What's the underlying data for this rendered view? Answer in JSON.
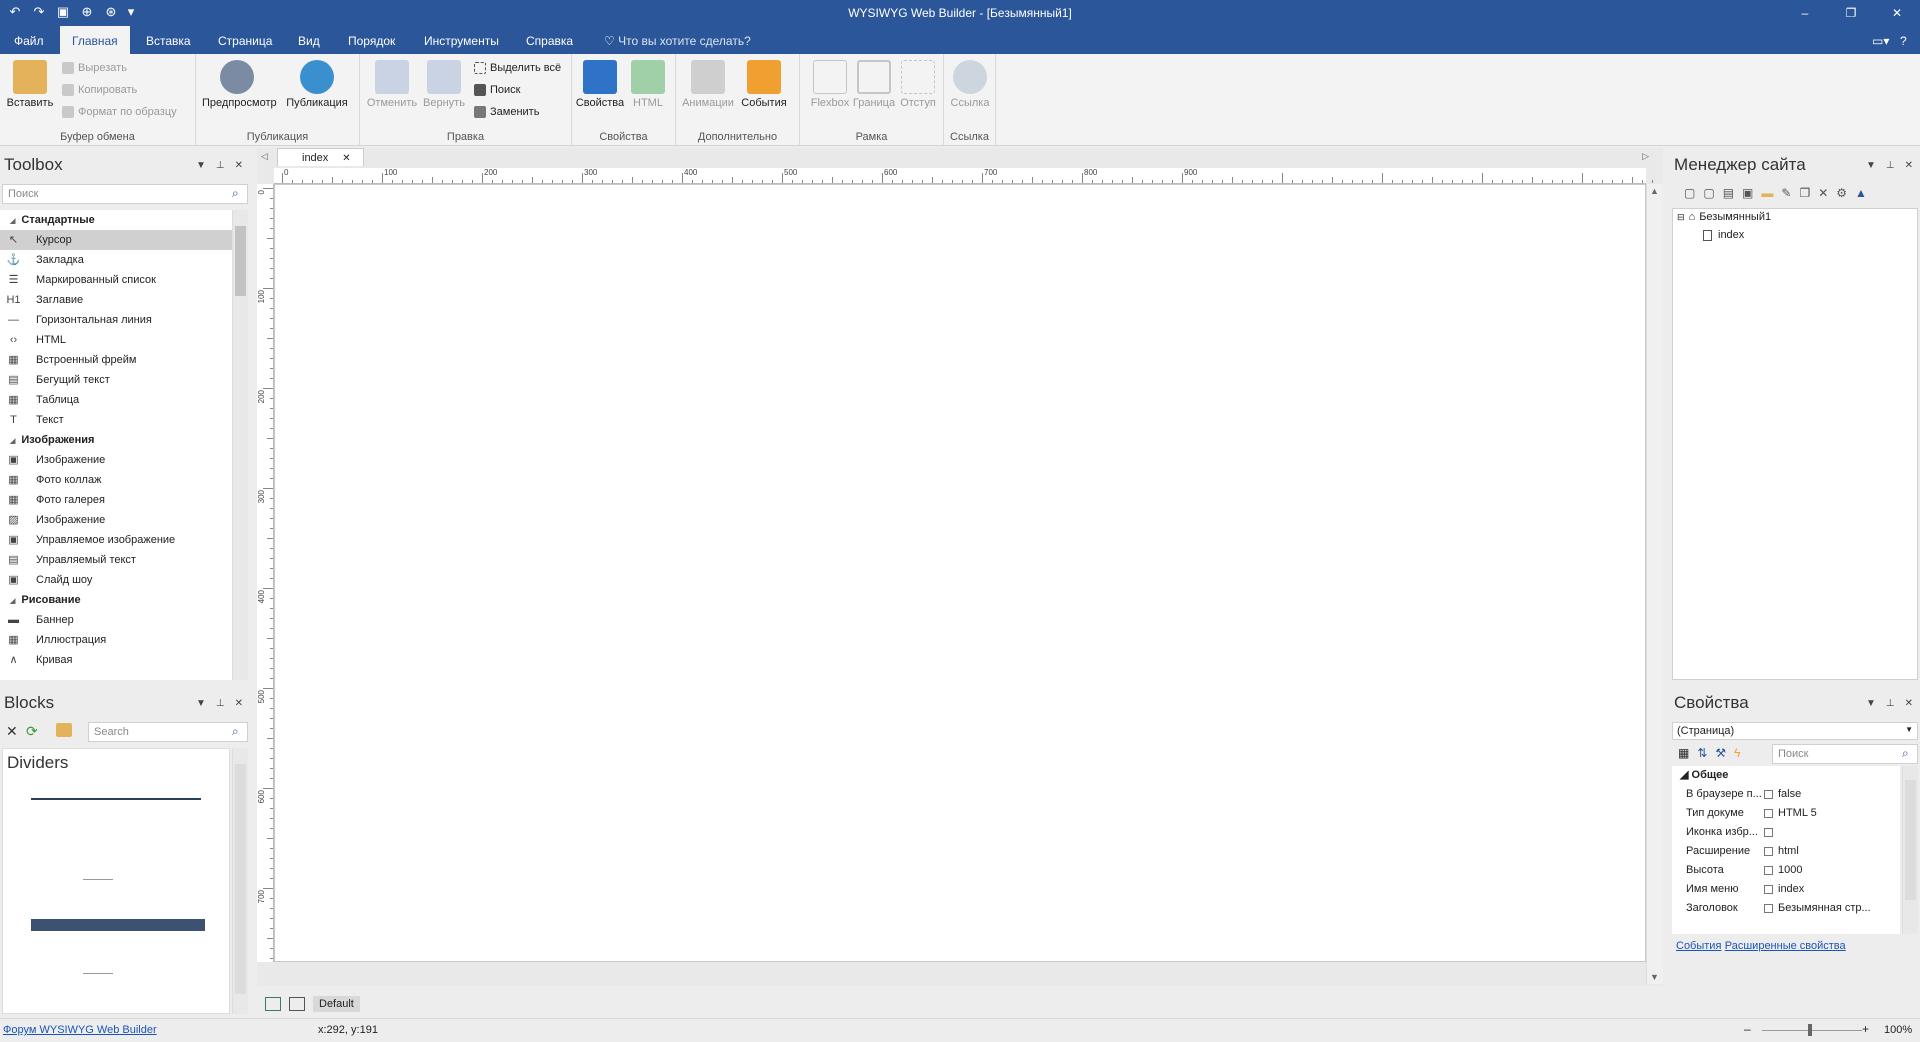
{
  "app": {
    "title": "WYSIWYG Web Builder - [Безымянный1]"
  },
  "quick_access": [
    "undo-icon",
    "redo-icon",
    "save-icon",
    "preview-icon",
    "publish-icon"
  ],
  "menu": {
    "tabs": [
      "Файл",
      "Главная",
      "Вставка",
      "Страница",
      "Вид",
      "Порядок",
      "Инструменты",
      "Справка"
    ],
    "active": "Главная",
    "tell_me": "Что вы хотите сделать?"
  },
  "ribbon": {
    "clipboard": {
      "label": "Буфер обмена",
      "paste": "Вставить",
      "cut": "Вырезать",
      "copy": "Копировать",
      "format_painter": "Формат по образцу"
    },
    "publish": {
      "label": "Публикация",
      "preview": "Предпросмотр",
      "publish": "Публикация"
    },
    "edit": {
      "label": "Правка",
      "undo": "Отменить",
      "redo": "Вернуть",
      "select_all": "Выделить всё",
      "find": "Поиск",
      "replace": "Заменить"
    },
    "props": {
      "label": "Свойства",
      "properties": "Свойства",
      "html": "HTML"
    },
    "extra": {
      "label": "Дополнительно",
      "animations": "Анимации",
      "events": "События"
    },
    "frame": {
      "label": "Рамка",
      "flexbox": "Flexbox",
      "border": "Граница",
      "padding": "Отступ"
    },
    "link": {
      "label": "Ссылка",
      "link": "Ссылка"
    }
  },
  "toolbox": {
    "title": "Toolbox",
    "search_placeholder": "Поиск",
    "categories": [
      {
        "name": "Стандартные",
        "items": [
          {
            "label": "Курсор",
            "icon": "cursor-icon",
            "selected": true
          },
          {
            "label": "Закладка",
            "icon": "anchor-icon"
          },
          {
            "label": "Маркированный список",
            "icon": "bullet-list-icon"
          },
          {
            "label": "Заглавие",
            "icon": "heading-icon"
          },
          {
            "label": "Горизонтальная линия",
            "icon": "hr-icon"
          },
          {
            "label": "HTML",
            "icon": "html-icon"
          },
          {
            "label": "Встроенный фрейм",
            "icon": "iframe-icon"
          },
          {
            "label": "Бегущий текст",
            "icon": "marquee-icon"
          },
          {
            "label": "Таблица",
            "icon": "table-icon"
          },
          {
            "label": "Текст",
            "icon": "text-icon"
          }
        ]
      },
      {
        "name": "Изображения",
        "items": [
          {
            "label": "Изображение",
            "icon": "image-icon"
          },
          {
            "label": "Фото коллаж",
            "icon": "collage-icon"
          },
          {
            "label": "Фото галерея",
            "icon": "gallery-icon"
          },
          {
            "label": "Изображение",
            "icon": "image2-icon"
          },
          {
            "label": "Управляемое изображение",
            "icon": "managed-image-icon"
          },
          {
            "label": "Управляемый текст",
            "icon": "managed-text-icon"
          },
          {
            "label": "Слайд шоу",
            "icon": "slideshow-icon"
          }
        ]
      },
      {
        "name": "Рисование",
        "items": [
          {
            "label": "Баннер",
            "icon": "banner-icon"
          },
          {
            "label": "Иллюстрация",
            "icon": "illustration-icon"
          },
          {
            "label": "Кривая",
            "icon": "curve-icon"
          }
        ]
      }
    ]
  },
  "blocks": {
    "title": "Blocks",
    "search_placeholder": "Search",
    "category": "Dividers"
  },
  "editor": {
    "tab": "index",
    "ruler_h": [
      "0",
      "100",
      "200",
      "300",
      "400",
      "500",
      "600",
      "700",
      "800",
      "900"
    ],
    "ruler_v": [
      "0",
      "100",
      "200",
      "300",
      "400",
      "500",
      "600",
      "700"
    ],
    "breakpoint": "Default"
  },
  "site_manager": {
    "title": "Менеджер сайта",
    "root": "Безымянный1",
    "page": "index"
  },
  "properties": {
    "title": "Свойства",
    "selector": "(Страница)",
    "search_placeholder": "Поиск",
    "section": "Общее",
    "rows": [
      {
        "name": "В браузере п...",
        "value": "false"
      },
      {
        "name": "Тип докуме",
        "value": "HTML 5"
      },
      {
        "name": "Иконка избр...",
        "value": ""
      },
      {
        "name": "Расширение",
        "value": "html"
      },
      {
        "name": "Высота",
        "value": "1000"
      },
      {
        "name": "Имя меню",
        "value": "index"
      },
      {
        "name": "Заголовок",
        "value": "Безымянная стр..."
      }
    ],
    "links": {
      "events": "События",
      "advanced": "Расширенные свойства"
    }
  },
  "status": {
    "forum_link": "Форум WYSIWYG Web Builder",
    "coords": "x:292, y:191",
    "zoom": "100%"
  },
  "colors": {
    "accent": "#2b579a",
    "link": "#1a55b5"
  }
}
